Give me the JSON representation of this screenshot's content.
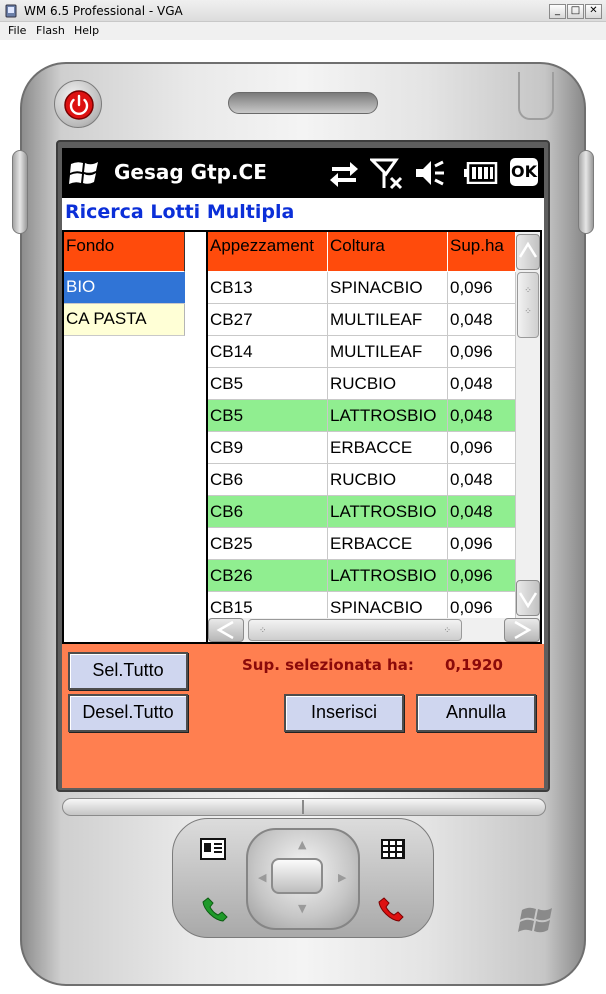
{
  "window": {
    "title": "WM 6.5 Professional - VGA",
    "minimize": "_",
    "maximize": "□",
    "close": "✕",
    "menu": [
      "File",
      "Flash",
      "Help"
    ]
  },
  "device": {
    "power_icon": "power-icon",
    "hardware_keys": [
      "contacts-icon",
      "call-icon",
      "grid-icon",
      "end-call-icon"
    ]
  },
  "taskbar": {
    "app_title": "Gesag Gtp.CE",
    "icons": [
      "sync-icon",
      "no-signal-icon",
      "volume-mute-icon",
      "battery-icon"
    ],
    "ok_label": "OK"
  },
  "form": {
    "title": "Ricerca Lotti Multipla",
    "fondo": {
      "header": "Fondo",
      "items": [
        {
          "label": "BIO",
          "selected": true
        },
        {
          "label": "CA  PASTA",
          "selected": false
        }
      ]
    },
    "grid": {
      "columns": [
        "Appezzament",
        "Coltura",
        "Sup.ha"
      ],
      "rows": [
        {
          "appezzamento": "CB13",
          "coltura": "SPINACBIO",
          "sup": "0,096",
          "highlight": false
        },
        {
          "appezzamento": "CB27",
          "coltura": "MULTILEAF",
          "sup": "0,048",
          "highlight": false
        },
        {
          "appezzamento": "CB14",
          "coltura": "MULTILEAF",
          "sup": "0,096",
          "highlight": false
        },
        {
          "appezzamento": "CB5",
          "coltura": "RUCBIO",
          "sup": "0,048",
          "highlight": false
        },
        {
          "appezzamento": "CB5",
          "coltura": "LATTROSBIO",
          "sup": "0,048",
          "highlight": true
        },
        {
          "appezzamento": "CB9",
          "coltura": "ERBACCE",
          "sup": "0,096",
          "highlight": false
        },
        {
          "appezzamento": "CB6",
          "coltura": "RUCBIO",
          "sup": "0,048",
          "highlight": false
        },
        {
          "appezzamento": "CB6",
          "coltura": "LATTROSBIO",
          "sup": "0,048",
          "highlight": true
        },
        {
          "appezzamento": "CB25",
          "coltura": "ERBACCE",
          "sup": "0,096",
          "highlight": false
        },
        {
          "appezzamento": "CB26",
          "coltura": "LATTROSBIO",
          "sup": "0,096",
          "highlight": true
        },
        {
          "appezzamento": "CB15",
          "coltura": "SPINACBIO",
          "sup": "0,096",
          "highlight": false
        }
      ]
    },
    "buttons": {
      "select_all": "Sel.Tutto",
      "deselect_all": "Desel.Tutto",
      "insert": "Inserisci",
      "cancel": "Annulla"
    },
    "sup_selected_label": "Sup. selezionata ha:",
    "sup_selected_value": "0,1920"
  },
  "colors": {
    "header_orange": "#ff4b0c",
    "panel_coral": "#ff7f50",
    "highlight_green": "#90ee90",
    "selected_blue": "#3074d6",
    "title_blue": "#0b2fd8",
    "sup_text": "#8b0a0a",
    "button_bg": "#cfd6ef"
  }
}
